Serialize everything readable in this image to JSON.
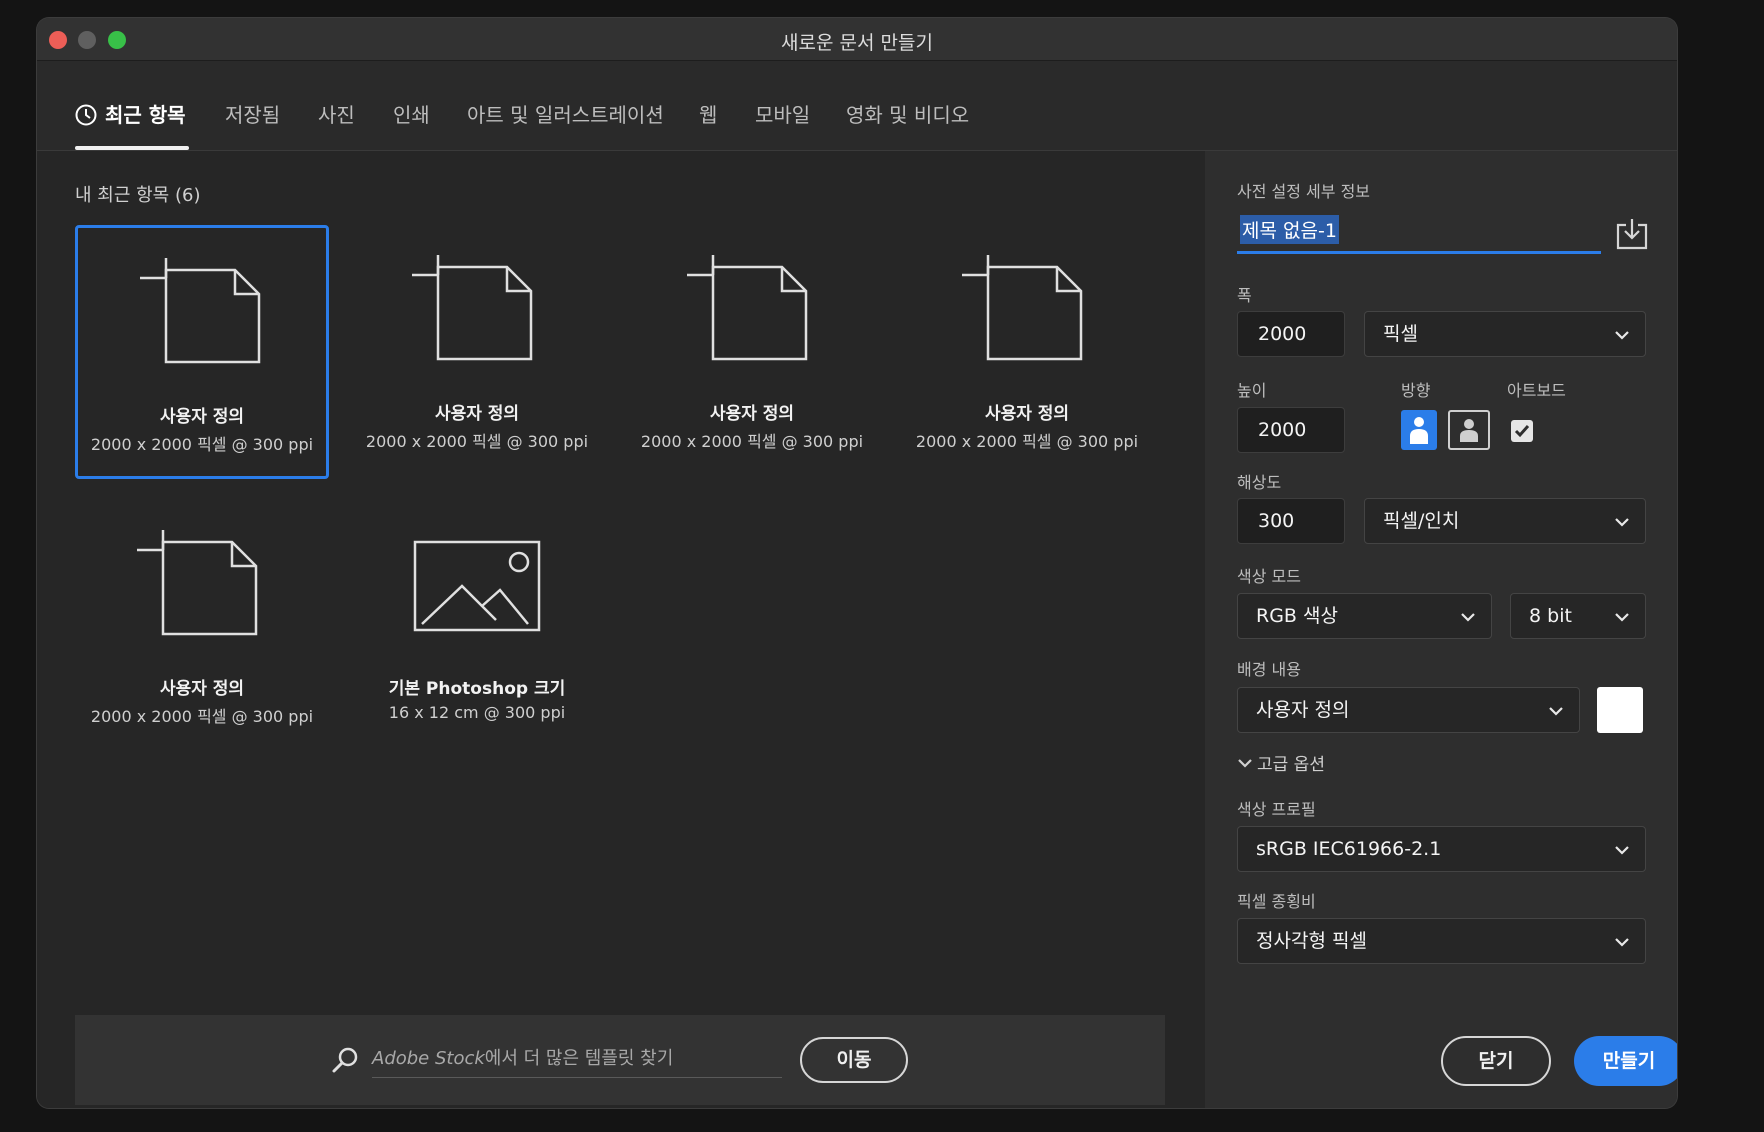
{
  "window": {
    "title": "새로운 문서 만들기"
  },
  "tabs": [
    {
      "label": "최근 항목",
      "icon": "clock-icon",
      "active": true
    },
    {
      "label": "저장됨"
    },
    {
      "label": "사진"
    },
    {
      "label": "인쇄"
    },
    {
      "label": "아트 및 일러스트레이션"
    },
    {
      "label": "웹"
    },
    {
      "label": "모바일"
    },
    {
      "label": "영화 및 비디오"
    }
  ],
  "recent": {
    "section_title": "내 최근 항목 (6)",
    "items": [
      {
        "name": "사용자 정의",
        "spec": "2000 x 2000 픽셀 @ 300 ppi",
        "icon": "blank-document-icon",
        "selected": true
      },
      {
        "name": "사용자 정의",
        "spec": "2000 x 2000 픽셀 @ 300 ppi",
        "icon": "blank-document-icon"
      },
      {
        "name": "사용자 정의",
        "spec": "2000 x 2000 픽셀 @ 300 ppi",
        "icon": "blank-document-icon"
      },
      {
        "name": "사용자 정의",
        "spec": "2000 x 2000 픽셀 @ 300 ppi",
        "icon": "blank-document-icon"
      },
      {
        "name": "사용자 정의",
        "spec": "2000 x 2000 픽셀 @ 300 ppi",
        "icon": "blank-document-icon"
      },
      {
        "name": "기본 Photoshop 크기",
        "spec": "16 x 12 cm @ 300 ppi",
        "icon": "image-placeholder-icon"
      }
    ]
  },
  "stock": {
    "placeholder_en": "Adobe Stock",
    "placeholder_ko": "에서 더 많은 템플릿 찾기",
    "go_label": "이동"
  },
  "preset": {
    "section_title": "사전 설정 세부 정보",
    "doc_name": "제목 없음-1",
    "width_label": "폭",
    "width_value": "2000",
    "width_unit": "픽셀",
    "height_label": "높이",
    "height_value": "2000",
    "orientation_label": "방향",
    "artboard_label": "아트보드",
    "artboard_checked": true,
    "resolution_label": "해상도",
    "resolution_value": "300",
    "resolution_unit": "픽셀/인치",
    "color_mode_label": "색상 모드",
    "color_mode": "RGB 색상",
    "bit_depth": "8 bit",
    "background_label": "배경 내용",
    "background": "사용자 정의",
    "background_color": "#ffffff",
    "advanced_label": "고급 옵션",
    "color_profile_label": "색상 프로필",
    "color_profile": "sRGB IEC61966-2.1",
    "pixel_aspect_label": "픽셀 종횡비",
    "pixel_aspect": "정사각형 픽셀"
  },
  "actions": {
    "close_label": "닫기",
    "create_label": "만들기"
  },
  "colors": {
    "accent": "#2b7de9",
    "panel": "#2e2e2e",
    "background": "#262626"
  }
}
